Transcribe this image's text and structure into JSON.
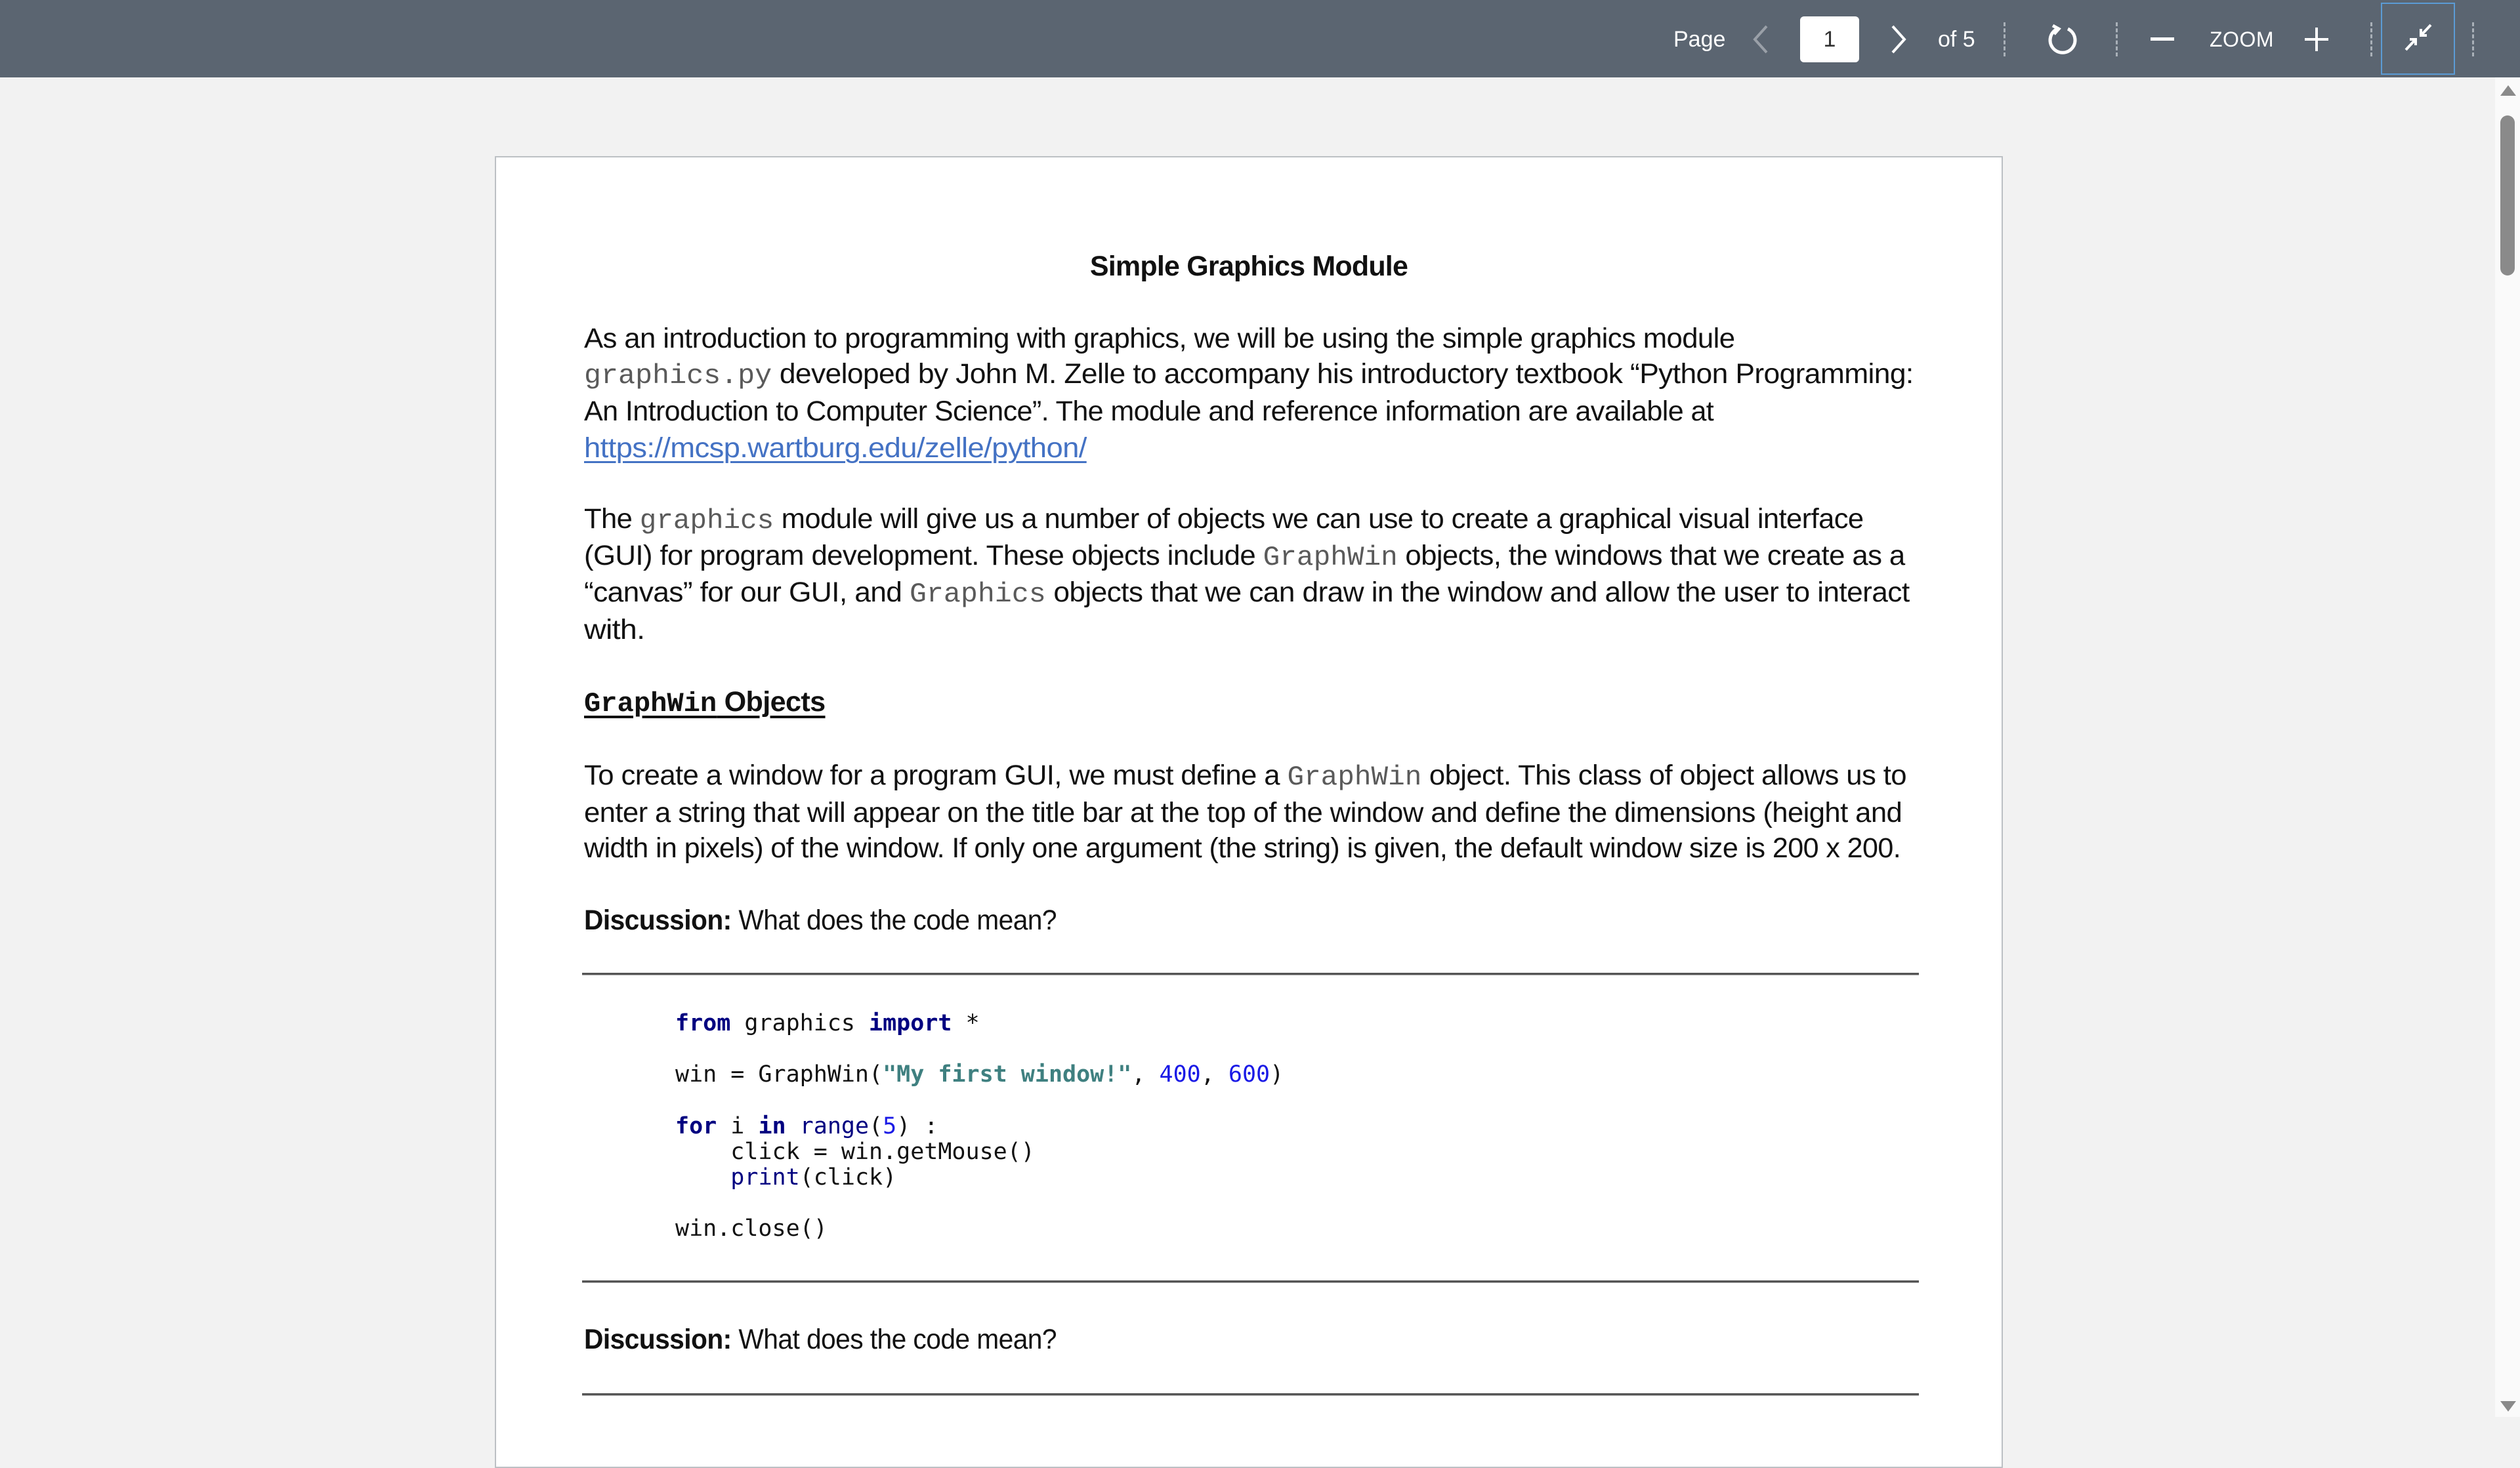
{
  "toolbar": {
    "page_label": "Page",
    "current_page": "1",
    "page_count_label": "of 5",
    "zoom_label": "ZOOM",
    "prev_icon": "chevron-left-icon",
    "next_icon": "chevron-right-icon",
    "rotate_icon": "rotate-clockwise-icon",
    "zoom_out_icon": "minus-icon",
    "zoom_in_icon": "plus-icon",
    "exit_fullscreen_icon": "exit-fullscreen-icon",
    "accent_color": "#5b9bd5",
    "background_color": "#5b6571"
  },
  "document": {
    "title": "Simple Graphics Module",
    "p1": {
      "l1": "As an introduction to programming with graphics, we will be using the simple graphics module",
      "l2_code": "graphics.py",
      "l2_text": " developed by John M. Zelle to accompany his introductory textbook “Python Programming:",
      "l3": "An Introduction to Computer Science”. The module and reference information are available at",
      "link": "https://mcsp.wartburg.edu/zelle/python/"
    },
    "p2": {
      "l1_a": "The ",
      "l1_code": "graphics",
      "l1_b": " module will give us a number of objects we can use to create a graphical visual interface",
      "l2_a": "(GUI) for program development. These objects include ",
      "l2_code": "GraphWin",
      "l2_b": " objects, the windows that we create as a",
      "l3_a": "“canvas” for our GUI, and ",
      "l3_code": "Graphics",
      "l3_b": " objects that we can draw in the window and allow the user to interact",
      "l4": "with."
    },
    "heading": {
      "code": "GraphWin",
      "text": " Objects"
    },
    "p3": {
      "l1_a": "To create a window for a program GUI, we must define a ",
      "l1_code": "GraphWin",
      "l1_b": " object. This class of object allows us to",
      "l2": "enter a string that will appear on the title bar at the top of the window and define the dimensions (height and",
      "l3": "width in pixels) of the window. If only one argument (the string) is given, the default window size is 200 x 200."
    },
    "discussion1": {
      "label": "Discussion:",
      "text": " What does the code mean?"
    },
    "code": {
      "l1": {
        "kw1": "from",
        "t1": " graphics ",
        "kw2": "import",
        "t2": " *"
      },
      "l2": {
        "t1": "win = GraphWin(",
        "str": "\"My first window!\"",
        "t2": ", ",
        "n1": "400",
        "t3": ", ",
        "n2": "600",
        "t4": ")"
      },
      "l3": {
        "kw1": "for",
        "t1": " i ",
        "kw2": "in",
        "t2": " ",
        "bi": "range",
        "t3": "(",
        "n": "5",
        "t4": ") :"
      },
      "l4": {
        "t1": "    click = win.getMouse()"
      },
      "l5": {
        "indent": "    ",
        "bi": "print",
        "t1": "(click)"
      },
      "l6": {
        "t1": "win.close()"
      }
    },
    "discussion2": {
      "label": "Discussion:",
      "text": " What does the code mean?"
    },
    "link_color": "#4472c4"
  }
}
